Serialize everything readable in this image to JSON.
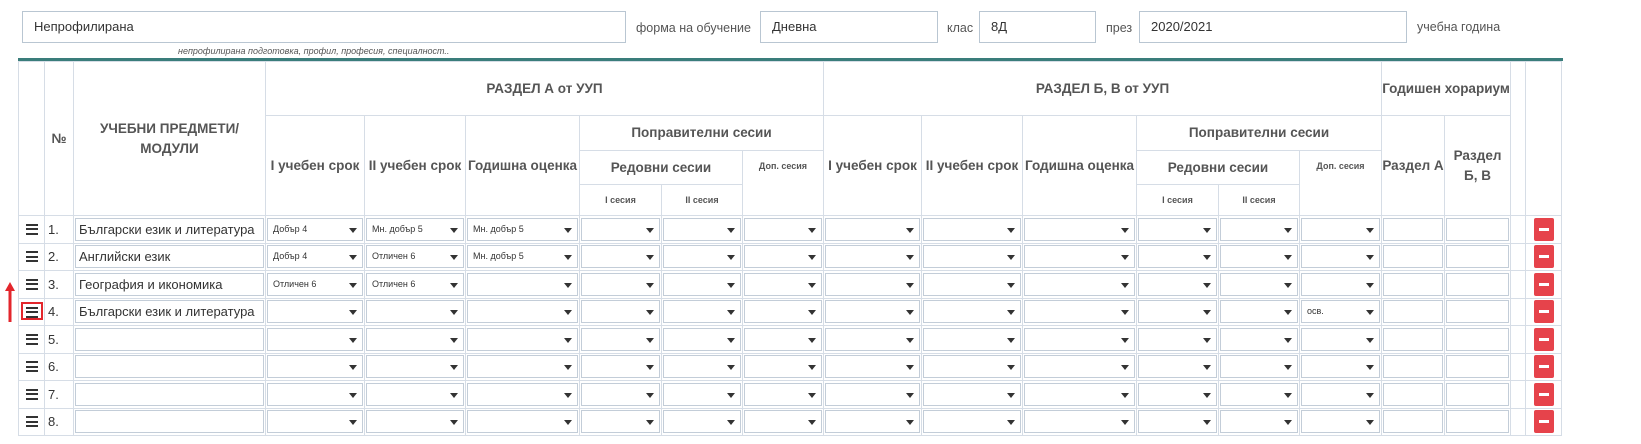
{
  "form": {
    "profile_value": "Непрофилирана",
    "profile_hint": "непрофилирана подготовка, профил, професия, специалност..",
    "education_form_label": "форма на обучение",
    "education_form_value": "Дневна",
    "class_label": "клас",
    "class_value": "8Д",
    "during_label": "през",
    "year_value": "2020/2021",
    "year_suffix": "учебна година"
  },
  "table": {
    "header": {
      "no": "№",
      "subjects": "УЧЕБНИ ПРЕДМЕТИ/ МОДУЛИ",
      "section_a": "РАЗДЕЛ А от УУП",
      "section_bv": "РАЗДЕЛ Б, В от УУП",
      "annual_hours": "Годишен хорариум",
      "term1": "I учебен срок",
      "term2": "II учебен срок",
      "annual_grade": "Годишна оценка",
      "makeup_sessions": "Поправителни сесии",
      "regular_sessions": "Редовни сесии",
      "additional_session": "Доп. сесия",
      "session1": "I сесия",
      "session2": "II сесия",
      "section_a_short": "Раздел А",
      "section_bv_short": "Раздел Б, В"
    },
    "rows": [
      {
        "num": "1.",
        "subject": "Български език и литература",
        "a_t1": "Добър 4",
        "a_t2": "Мн. добър 5",
        "a_annual": "Мн. добър 5",
        "a_s1": "",
        "a_s2": "",
        "a_add": "",
        "b_t1": "",
        "b_t2": "",
        "b_annual": "",
        "b_s1": "",
        "b_s2": "",
        "b_add": ""
      },
      {
        "num": "2.",
        "subject": "Английски език",
        "a_t1": "Добър 4",
        "a_t2": "Отличен 6",
        "a_annual": "Мн. добър 5",
        "a_s1": "",
        "a_s2": "",
        "a_add": "",
        "b_t1": "",
        "b_t2": "",
        "b_annual": "",
        "b_s1": "",
        "b_s2": "",
        "b_add": ""
      },
      {
        "num": "3.",
        "subject": "География и икономика",
        "a_t1": "Отличен 6",
        "a_t2": "Отличен 6",
        "a_annual": "",
        "a_s1": "",
        "a_s2": "",
        "a_add": "",
        "b_t1": "",
        "b_t2": "",
        "b_annual": "",
        "b_s1": "",
        "b_s2": "",
        "b_add": ""
      },
      {
        "num": "4.",
        "subject": "Български език и литература",
        "a_t1": "",
        "a_t2": "",
        "a_annual": "",
        "a_s1": "",
        "a_s2": "",
        "a_add": "",
        "b_t1": "",
        "b_t2": "",
        "b_annual": "",
        "b_s1": "",
        "b_s2": "",
        "b_add": "осв."
      },
      {
        "num": "5.",
        "subject": "",
        "a_t1": "",
        "a_t2": "",
        "a_annual": "",
        "a_s1": "",
        "a_s2": "",
        "a_add": "",
        "b_t1": "",
        "b_t2": "",
        "b_annual": "",
        "b_s1": "",
        "b_s2": "",
        "b_add": ""
      },
      {
        "num": "6.",
        "subject": "",
        "a_t1": "",
        "a_t2": "",
        "a_annual": "",
        "a_s1": "",
        "a_s2": "",
        "a_add": "",
        "b_t1": "",
        "b_t2": "",
        "b_annual": "",
        "b_s1": "",
        "b_s2": "",
        "b_add": ""
      },
      {
        "num": "7.",
        "subject": "",
        "a_t1": "",
        "a_t2": "",
        "a_annual": "",
        "a_s1": "",
        "a_s2": "",
        "a_add": "",
        "b_t1": "",
        "b_t2": "",
        "b_annual": "",
        "b_s1": "",
        "b_s2": "",
        "b_add": ""
      },
      {
        "num": "8.",
        "subject": "",
        "a_t1": "",
        "a_t2": "",
        "a_annual": "",
        "a_s1": "",
        "a_s2": "",
        "a_add": "",
        "b_t1": "",
        "b_t2": "",
        "b_annual": "",
        "b_s1": "",
        "b_s2": "",
        "b_add": ""
      }
    ]
  },
  "colors": {
    "accent_rule": "#3a7d7b",
    "delete_button": "#e6434b",
    "highlight": "#e3262c"
  },
  "icons": {
    "drag_handle": "hamburger-icon",
    "delete": "minus-icon",
    "move_indicator": "arrow-up-icon",
    "dropdown": "caret-down-icon"
  }
}
